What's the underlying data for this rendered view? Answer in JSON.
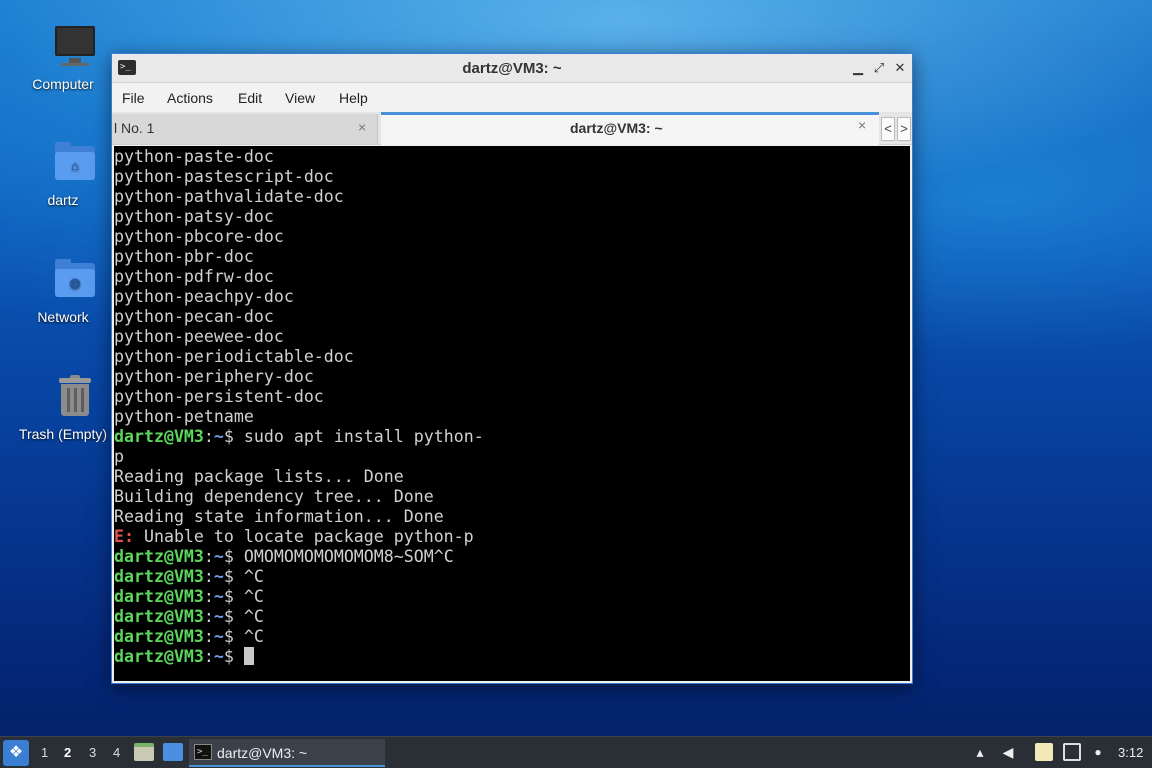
{
  "desktop": {
    "icons": [
      {
        "label": "Computer",
        "icon": "computer-icon"
      },
      {
        "label": "dartz",
        "icon": "home-folder-icon"
      },
      {
        "label": "Network",
        "icon": "network-folder-icon"
      },
      {
        "label": "Trash (Empty)",
        "icon": "trash-icon"
      }
    ]
  },
  "window": {
    "title": "dartz@VM3: ~",
    "menu": [
      "File",
      "Actions",
      "Edit",
      "View",
      "Help"
    ],
    "tabs": [
      {
        "label": "l No. 1",
        "close": "×"
      },
      {
        "label": "dartz@VM3: ~",
        "close": "×"
      }
    ],
    "buttons": {
      "minimize": "‗",
      "maximize": "⤢",
      "close": "✕"
    },
    "tab_scroll": {
      "left": "<",
      "right": ">"
    }
  },
  "terminal": {
    "prompt_user": "dartz@VM3",
    "prompt_sep": ":",
    "prompt_dir": "~",
    "prompt_sym": "$",
    "lines": [
      "python-paste-doc",
      "python-pastescript-doc",
      "python-pathvalidate-doc",
      "python-patsy-doc",
      "python-pbcore-doc",
      "python-pbr-doc",
      "python-pdfrw-doc",
      "python-peachpy-doc",
      "python-pecan-doc",
      "python-peewee-doc",
      "python-periodictable-doc",
      "python-periphery-doc",
      "python-persistent-doc",
      "python-petname"
    ],
    "command1": " sudo apt install python-",
    "command1_wrap": "p",
    "output": [
      "Reading package lists... Done",
      "Building dependency tree... Done",
      "Reading state information... Done"
    ],
    "error_tag": "E:",
    "error_msg": " Unable to locate package python-p",
    "command2": " OMOMOMOMOMOMOM8~SOM^C",
    "ctrl_c": " ^C"
  },
  "taskbar": {
    "workspaces": [
      "1",
      "2",
      "3",
      "4"
    ],
    "active_workspace": "2",
    "task_label": "dartz@VM3: ~",
    "clock": "3:12"
  }
}
